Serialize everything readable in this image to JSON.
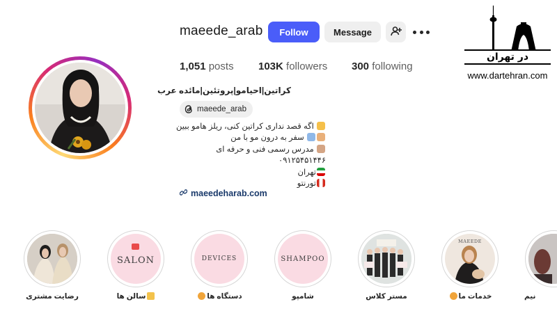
{
  "profile": {
    "username": "maeede_arab",
    "full_name": "کراتین|احیامو|پروتئین|مائده عرب",
    "threads_handle": "maeede_arab",
    "link": "maeedeharab.com",
    "bio_lines": [
      "اگه قصد نداری کراتین کنی، ریلز هامو ببین",
      "سفر به درون مو با من",
      "مدرس رسمی فنی و حرفه ای",
      "۰۹۱۲۵۴۵۱۴۴۶",
      "تهران",
      "تورنتو"
    ]
  },
  "actions": {
    "follow_label": "Follow",
    "message_label": "Message",
    "add_user_icon": "person-add-icon",
    "more_icon": "more-horizontal-icon"
  },
  "stats": {
    "posts_count": "1,051",
    "posts_label": "posts",
    "followers_count": "103K",
    "followers_label": "followers",
    "following_count": "300",
    "following_label": "following"
  },
  "watermark": {
    "brand_fa": "در تهران",
    "url": "www.dartehran.com"
  },
  "highlights": [
    {
      "label": "رضایت مشتری",
      "cover_text": ""
    },
    {
      "label": "سالن ها",
      "cover_text": "SALON"
    },
    {
      "label": "دستگاه ها",
      "cover_text": "DEVICES"
    },
    {
      "label": "شامپو",
      "cover_text": "SHAMPOO"
    },
    {
      "label": "مستر کلاس",
      "cover_text": ""
    },
    {
      "label": "خدمات ما",
      "cover_text": "MAEEDE"
    },
    {
      "label": "نیم",
      "cover_text": ""
    }
  ],
  "colors": {
    "follow_button": "#4a5df9",
    "secondary_button": "#efefef",
    "highlight_pink": "#fadbe3",
    "link": "#1a3a6b"
  }
}
